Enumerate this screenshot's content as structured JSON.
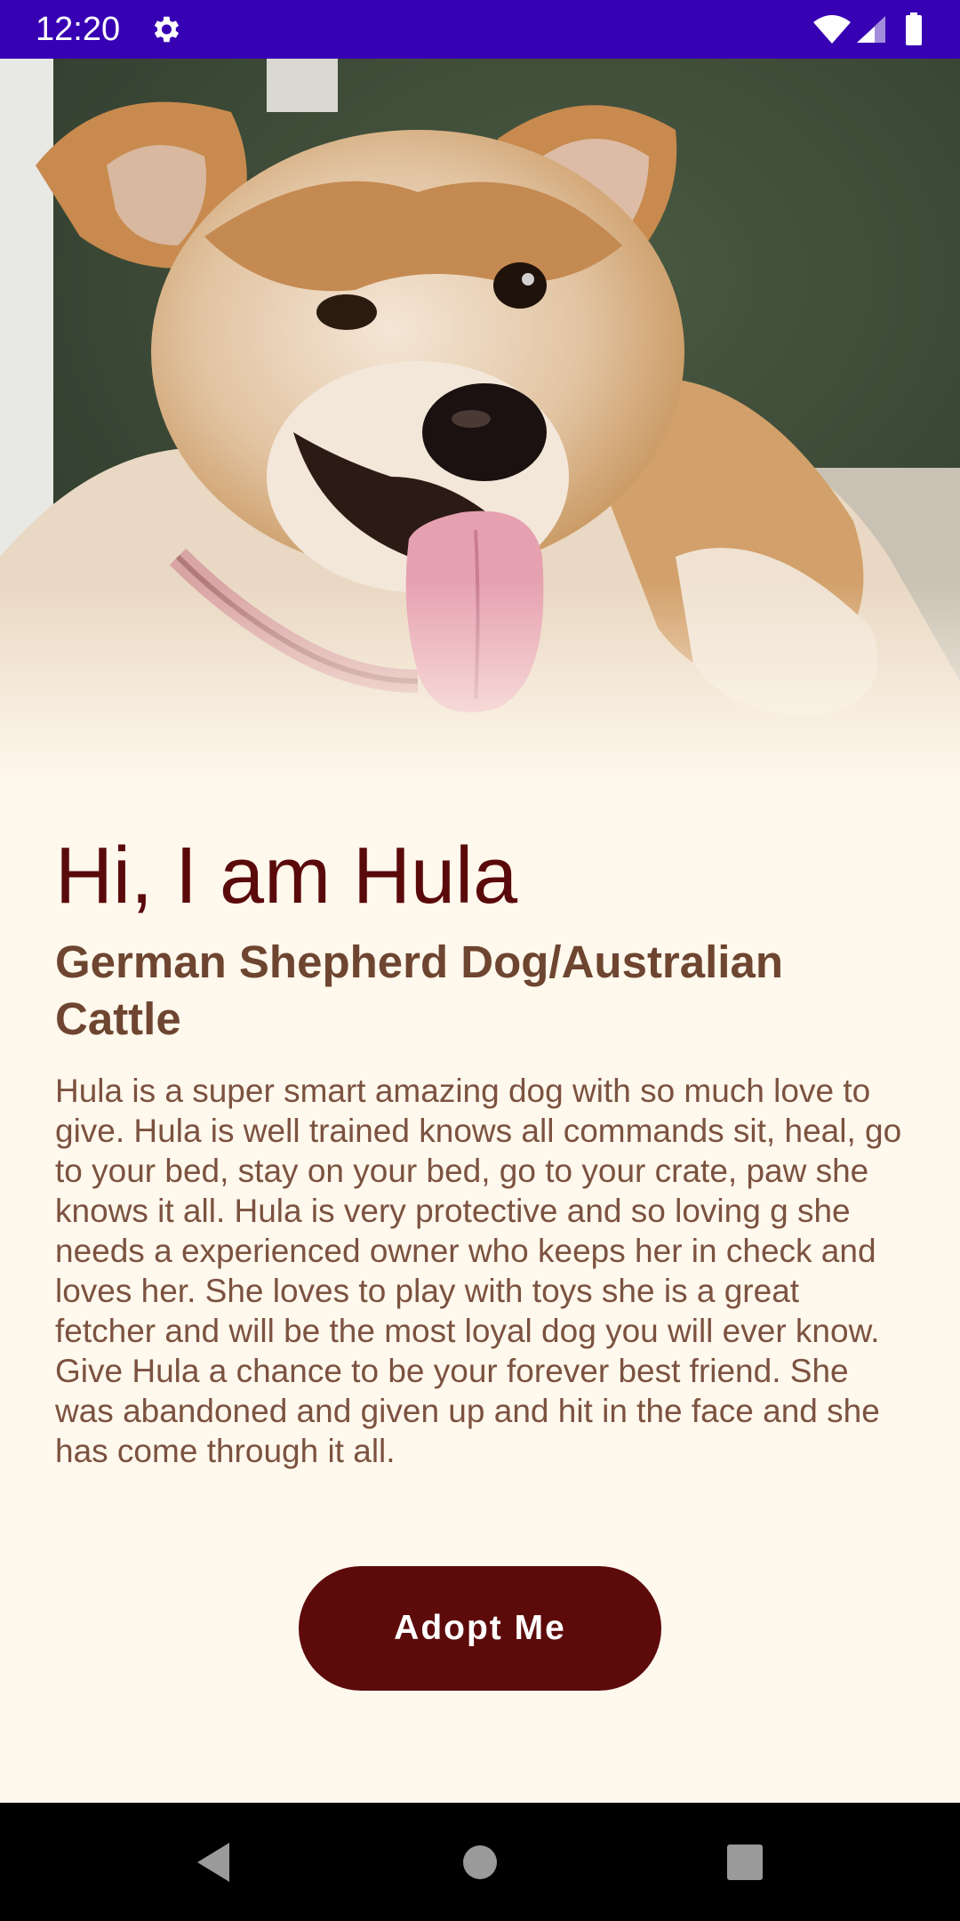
{
  "status_bar": {
    "time": "12:20",
    "background": "#3700b3",
    "icons": [
      "gear-icon",
      "wifi-icon",
      "signal-icon",
      "battery-icon"
    ]
  },
  "hero": {
    "image": "dog-photo"
  },
  "pet": {
    "greeting": "Hi, I am Hula",
    "breed": "German Shepherd Dog/Australian Cattle",
    "description": "Hula is a super smart amazing dog with so much love to give. Hula is well trained knows all commands sit, heal, go to your bed, stay on your bed, go to your crate, paw she knows it all. Hula is very protective and so loving g she needs a experienced owner who keeps her in check and loves her. She loves to play with toys she is a great fetcher and will be the most loyal dog you will ever know. Give Hula a chance to be your forever best friend. She was abandoned and given up and hit in the face and she has come through it all."
  },
  "actions": {
    "adopt_label": "Adopt Me"
  },
  "nav_bar": {
    "icons": [
      "back-icon",
      "home-icon",
      "recents-icon"
    ]
  },
  "colors": {
    "background": "#fff8ed",
    "title": "#5b0a0b",
    "subtitle": "#6e4530",
    "body_text": "#7c5240",
    "button": "#5d0a0b",
    "status_bar": "#3700b3",
    "nav_bar": "#000000"
  }
}
